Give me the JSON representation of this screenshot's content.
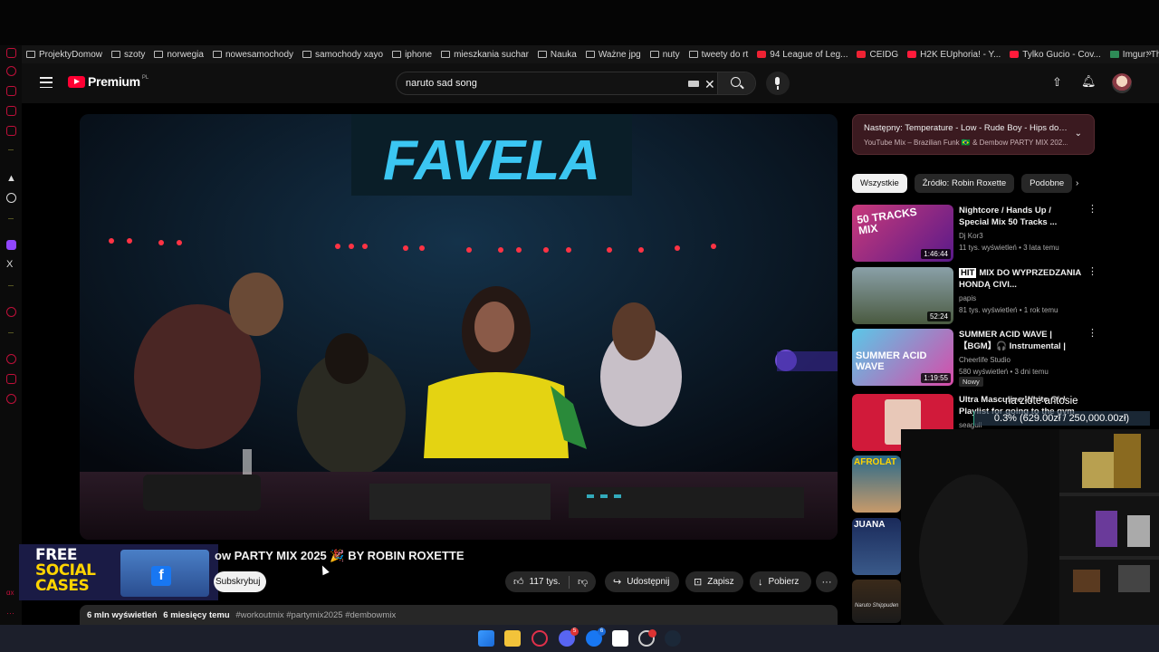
{
  "bookmarks": [
    {
      "label": "ProjektyDomow",
      "icon": "folder-icon"
    },
    {
      "label": "szoty",
      "icon": "folder-icon"
    },
    {
      "label": "norwegia",
      "icon": "folder-icon"
    },
    {
      "label": "nowesamochody",
      "icon": "folder-icon"
    },
    {
      "label": "samochody xayo",
      "icon": "folder-icon"
    },
    {
      "label": "iphone",
      "icon": "folder-icon"
    },
    {
      "label": "mieszkania suchar",
      "icon": "folder-icon"
    },
    {
      "label": "Nauka",
      "icon": "folder-icon"
    },
    {
      "label": "Ważne jpg",
      "icon": "folder-icon"
    },
    {
      "label": "nuty",
      "icon": "folder-icon"
    },
    {
      "label": "tweety do rt",
      "icon": "folder-icon"
    },
    {
      "label": "94 League of Leg...",
      "icon": "league-icon"
    },
    {
      "label": "CEIDG",
      "icon": "ceidg-icon"
    },
    {
      "label": "H2K EUphoria! - Y...",
      "icon": "youtube-icon"
    },
    {
      "label": "Tylko Gucio - Cov...",
      "icon": "youtube-icon"
    },
    {
      "label": "Imgur: The most a...",
      "icon": "imgur-icon"
    }
  ],
  "header": {
    "logo_text": "Premium",
    "logo_region": "PL",
    "search_value": "naruto sad song"
  },
  "video": {
    "title": "ow PARTY MIX 2025 🎉 BY ROBIN ROXETTE",
    "subscribe_label": "Subskrybuj",
    "likes": "117 tys.",
    "share_label": "Udostępnij",
    "save_label": "Zapisz",
    "download_label": "Pobierz",
    "views": "6 mln wyświetleń",
    "age": "6 miesięcy temu",
    "tags": "#workoutmix #partymix2025 #dembowmix",
    "sign_text": "FAVELA"
  },
  "ad": {
    "line1": "FREE",
    "line2": "SOCIAL",
    "line3": "CASES"
  },
  "up_next": {
    "title": "Następny: Temperature - Low - Rude Boy - Hips don...",
    "subtitle": "YouTube Mix – Brazilian Funk 🇧🇷 & Dembow PARTY MIX 202..."
  },
  "chips": [
    "Wszystkie",
    "Źródło: Robin Roxette",
    "Podobne"
  ],
  "recommendations": [
    {
      "title": "Nightcore / Hands Up / Special Mix 50 Tracks ...",
      "channel": "Dj Kor3",
      "meta": "11 tys. wyświetleń • 3 lata temu",
      "duration": "1:46:44",
      "thumb_text": "50 TRACKS MIX"
    },
    {
      "title": "MIX DO WYPRZEDZANIA HONDĄ CIVI...",
      "title_prefix": "HIT",
      "channel": "papis",
      "meta": "81 tys. wyświetleń • 1 rok temu",
      "duration": "52:24",
      "thumb_text": ""
    },
    {
      "title": "SUMMER ACID WAVE | 【BGM】🎧 Instrumental | Pu...",
      "channel": "Cheerlife Studio",
      "meta": "580 wyświetleń • 3 dni temu",
      "duration": "1:19:55",
      "badge": "Nowy",
      "thumb_text": "SUMMER ACID WAVE"
    },
    {
      "title": "Ultra Masculine White Girl Playlist for going to the gym",
      "channel": "seagull",
      "meta": "",
      "duration": "",
      "thumb_text": ""
    }
  ],
  "small_thumbs": [
    "AFROLAT",
    "JUANA",
    "Naruto Shippuden"
  ],
  "donation": {
    "name": "na złote antosie",
    "progress_text": "0.3% (629.00zł / 250,000.00zł)",
    "progress_fraction": 0.003
  },
  "colors": {
    "accent_red": "#ff0033",
    "bg": "#0f0f0f",
    "pill": "#272727"
  }
}
